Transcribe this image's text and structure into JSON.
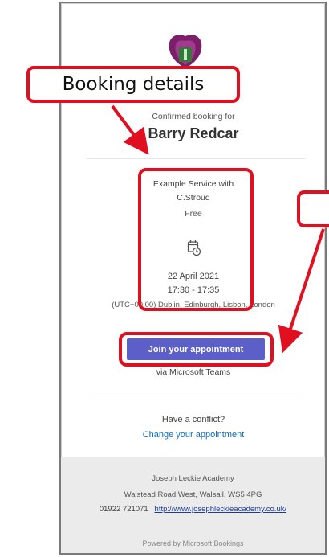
{
  "booking": {
    "confirmed_label": "Confirmed booking for",
    "customer_name": "Barry Redcar"
  },
  "service": {
    "name_line1": "Example Service with",
    "name_line2": "C.Stroud",
    "price": "Free",
    "date": "22 April 2021",
    "time": "17:30 - 17:35",
    "timezone": "(UTC+00:00) Dublin, Edinburgh, Lisbon, London"
  },
  "meeting": {
    "join_label": "Join your appointment",
    "via_label": "via Microsoft Teams"
  },
  "conflict": {
    "question": "Have a conflict?",
    "change_label": "Change your appointment"
  },
  "footer": {
    "org_name": "Joseph Leckie Academy",
    "address": "Walstead Road West, Walsall, WS5 4PG",
    "phone": "01922 721071",
    "website": "http://www.josephleckieacademy.co.uk/",
    "powered_by": "Powered by Microsoft Bookings"
  },
  "annotations": {
    "booking_details_label": "Booking details"
  },
  "colors": {
    "join_button": "#5b5fc7",
    "link": "#0f6cbd",
    "annotation": "#e01020",
    "footer_bg": "#ebebeb"
  },
  "icons": [
    "school-logo-icon",
    "calendar-clock-icon"
  ]
}
